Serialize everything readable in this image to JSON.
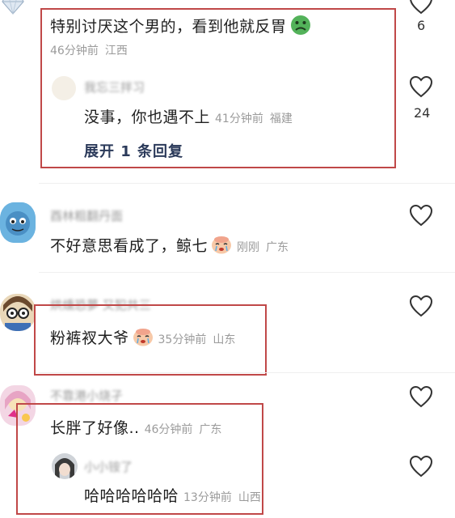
{
  "comments": [
    {
      "text": "特别讨厌这个男的，看到他就反胃",
      "time": "46分钟前",
      "location": "江西",
      "likes": "6",
      "reply": {
        "author": "我忘三拌习",
        "text": "没事，你也遇不上",
        "time": "41分钟前",
        "location": "福建",
        "likes": "24"
      },
      "expand_label": "展开 1 条回复"
    },
    {
      "author": "酉林粗翻丹面",
      "text": "不好意思看成了，鲸七",
      "time": "刚刚",
      "location": "广东"
    },
    {
      "author": "烘燻恐夢 又犯共三",
      "text": "粉裤衩大爷",
      "time": "35分钟前",
      "location": "山东"
    },
    {
      "author": "不靠港小烧孑",
      "text": "长胖了好像..",
      "time": "46分钟前",
      "location": "广东",
      "reply": {
        "author": "小小铵了",
        "text": "哈哈哈哈哈哈",
        "time": "13分钟前",
        "location": "山西"
      }
    }
  ],
  "colors": {
    "highlight_box": "#c04848",
    "expand_link": "#2b3a5a",
    "meta_text": "#9b9b9b"
  },
  "icons": [
    "diamond-icon",
    "heart-outline-icon",
    "nauseated-face-emoji",
    "crying-face-emoji"
  ]
}
